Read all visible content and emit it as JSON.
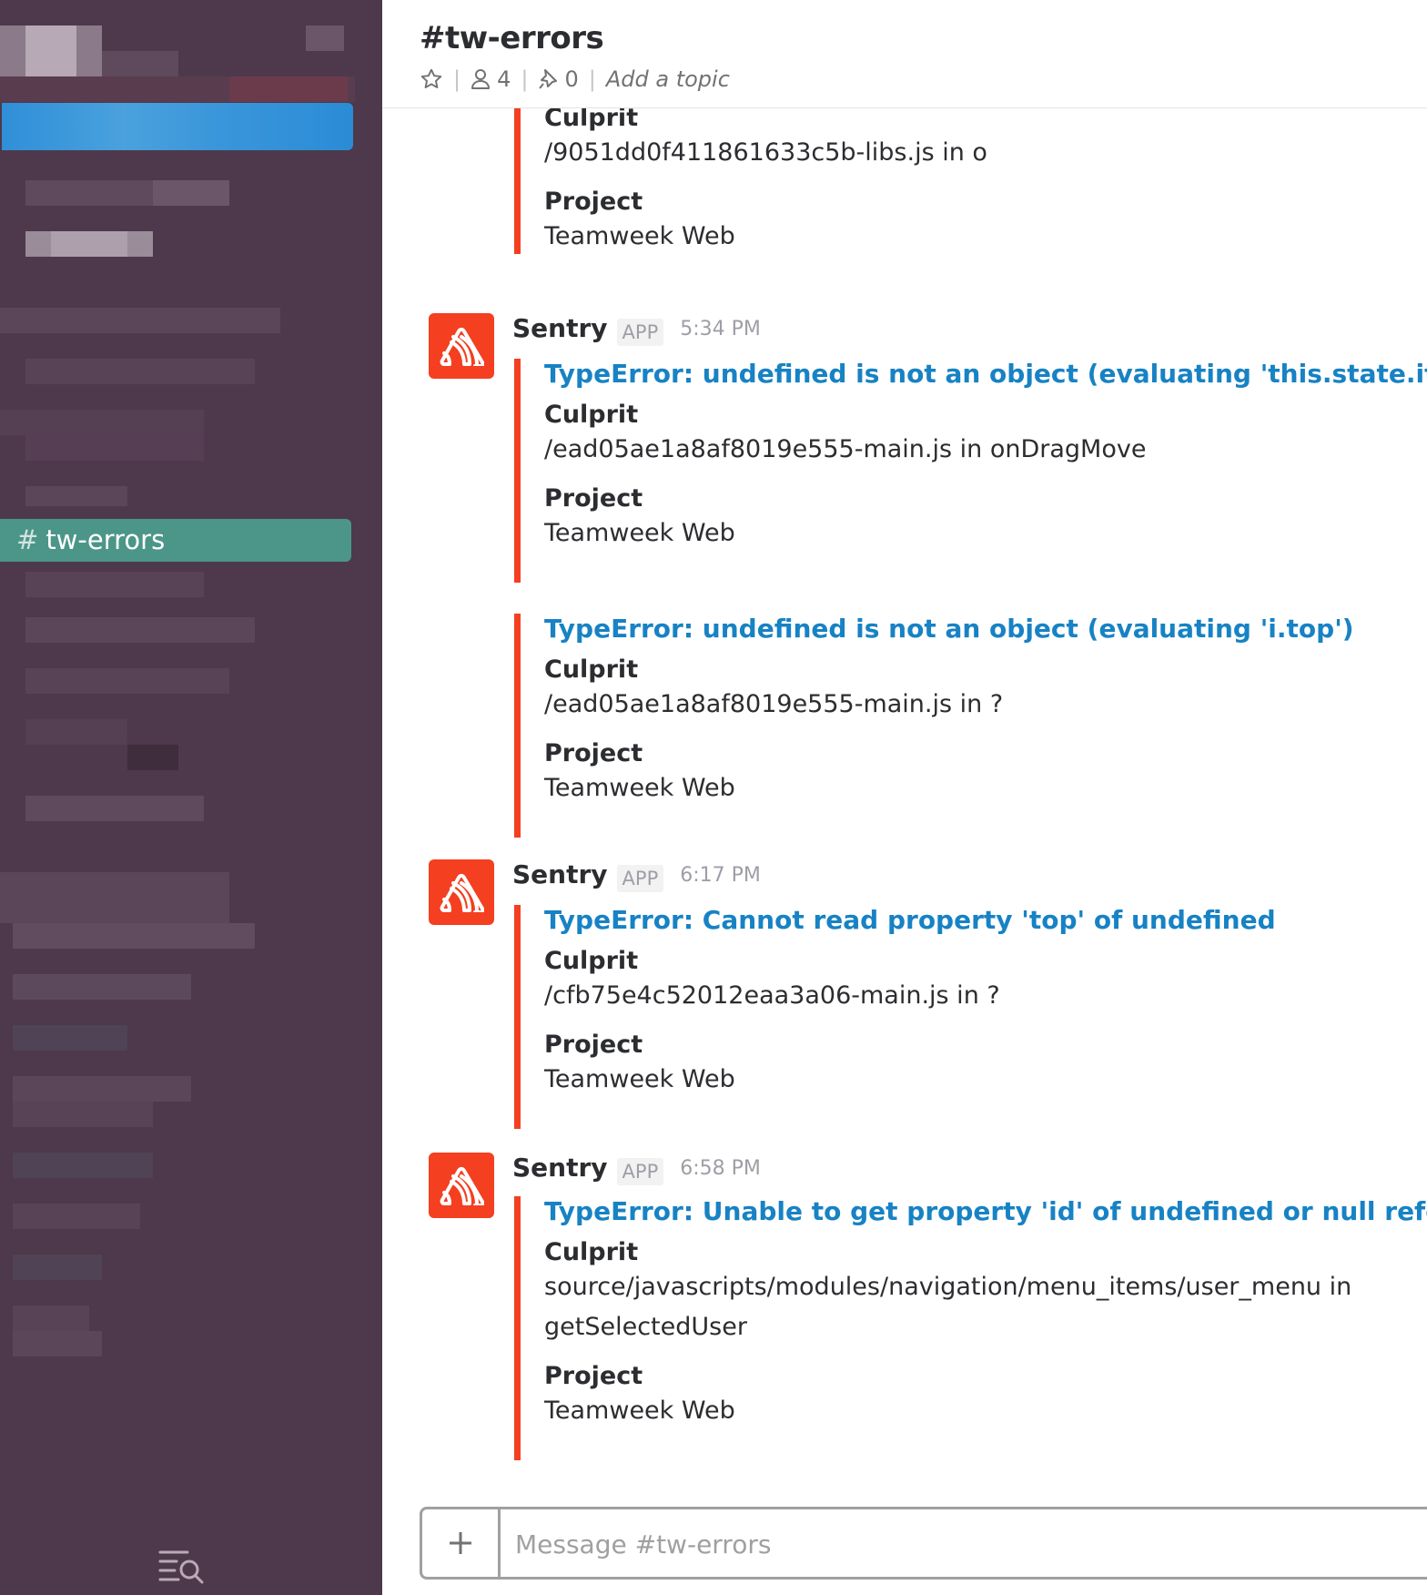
{
  "sidebar": {
    "active_channel": {
      "hash": "#",
      "name": "tw-errors"
    }
  },
  "header": {
    "channel_title": "#tw-errors",
    "member_count": "4",
    "pinned_count": "0",
    "topic_placeholder": "Add a topic"
  },
  "messages": {
    "m0": {
      "culprit_label": "Culprit",
      "culprit": "/9051dd0f411861633c5b-libs.js in o",
      "project_label": "Project",
      "project": "Teamweek Web"
    },
    "m1": {
      "sender": "Sentry",
      "badge": "APP",
      "time": "5:34 PM",
      "a1": {
        "title": "TypeError: undefined is not an object (evaluating 'this.state.items')",
        "culprit_label": "Culprit",
        "culprit": "/ead05ae1a8af8019e555-main.js in onDragMove",
        "project_label": "Project",
        "project": "Teamweek Web"
      },
      "a2": {
        "title": "TypeError: undefined is not an object (evaluating 'i.top')",
        "culprit_label": "Culprit",
        "culprit": "/ead05ae1a8af8019e555-main.js in ?",
        "project_label": "Project",
        "project": "Teamweek Web"
      }
    },
    "m2": {
      "sender": "Sentry",
      "badge": "APP",
      "time": "6:17 PM",
      "title": "TypeError: Cannot read property 'top' of undefined",
      "culprit_label": "Culprit",
      "culprit": "/cfb75e4c52012eaa3a06-main.js in ?",
      "project_label": "Project",
      "project": "Teamweek Web"
    },
    "m3": {
      "sender": "Sentry",
      "badge": "APP",
      "time": "6:58 PM",
      "title": "TypeError: Unable to get property 'id' of undefined or null reference",
      "culprit_label": "Culprit",
      "culprit_line1": "source/javascripts/modules/navigation/menu_items/user_menu in",
      "culprit_line2": "getSelectedUser",
      "project_label": "Project",
      "project": "Teamweek Web"
    }
  },
  "composer": {
    "placeholder": "Message #tw-errors",
    "attach_symbol": "+"
  },
  "colors": {
    "sidebar_bg": "#4d394b",
    "active_channel": "#4c9689",
    "attachment_bar": "#f43f20",
    "link": "#1782c4",
    "sentry_avatar": "#f43f20"
  }
}
